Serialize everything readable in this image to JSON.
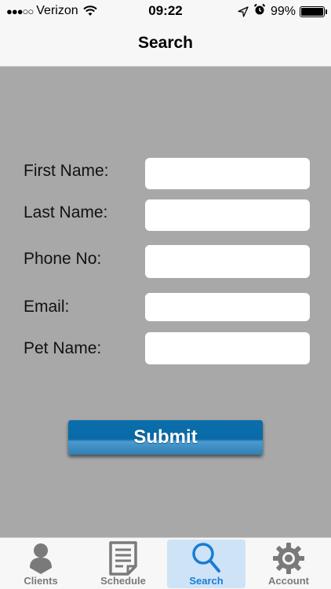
{
  "status_bar": {
    "signal": "●●●○○",
    "carrier": "Verizon",
    "wifi_icon": "wifi-icon",
    "time": "09:22",
    "location_icon": "location-arrow-icon",
    "alarm_icon": "alarm-clock-icon",
    "battery_percent": "99%",
    "battery_level": 0.99
  },
  "nav": {
    "title": "Search"
  },
  "form": {
    "fields": [
      {
        "label": "First Name:",
        "value": "",
        "placeholder": ""
      },
      {
        "label": "Last Name:",
        "value": "",
        "placeholder": ""
      },
      {
        "label": "Phone No:",
        "value": "",
        "placeholder": ""
      },
      {
        "label": "Email:",
        "value": "",
        "placeholder": ""
      },
      {
        "label": "Pet Name:",
        "value": "",
        "placeholder": ""
      }
    ],
    "submit_label": "Submit"
  },
  "tabs": [
    {
      "label": "Clients",
      "icon": "person-icon",
      "active": false
    },
    {
      "label": "Schedule",
      "icon": "document-icon",
      "active": false
    },
    {
      "label": "Search",
      "icon": "search-icon",
      "active": true
    },
    {
      "label": "Account",
      "icon": "gear-icon",
      "active": false
    }
  ],
  "colors": {
    "content_background": "#a8a8a8",
    "submit_button": "#0b6eab",
    "tab_active_text": "#1a7cd6",
    "tab_active_background": "#cfe3f6",
    "tab_inactive": "#7a7a7a"
  }
}
